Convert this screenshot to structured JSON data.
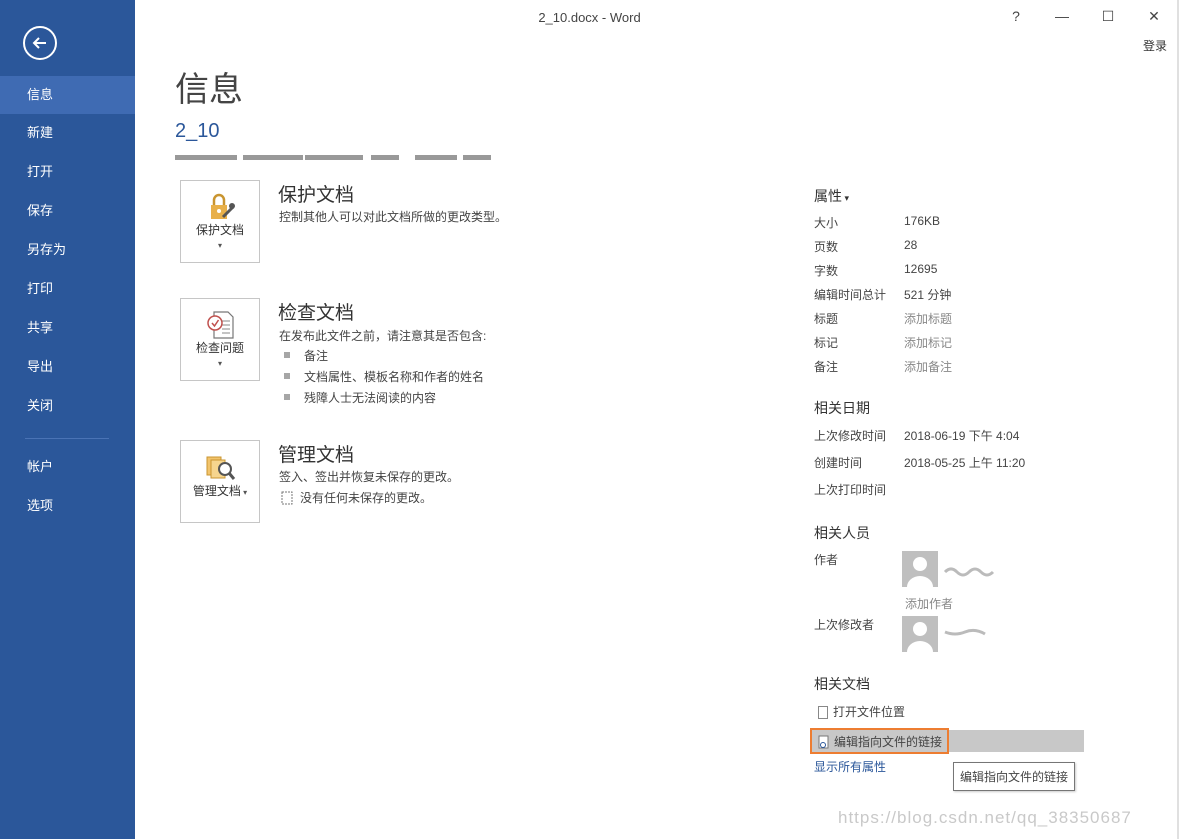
{
  "window": {
    "title": "2_10.docx - Word",
    "help_glyph": "?",
    "minimize_glyph": "—",
    "maximize_glyph": "☐",
    "close_glyph": "✕",
    "signin_label": "登录"
  },
  "sidebar": {
    "back_icon": "back-arrow-icon",
    "items": [
      {
        "label": "信息",
        "active": true
      },
      {
        "label": "新建"
      },
      {
        "label": "打开"
      },
      {
        "label": "保存"
      },
      {
        "label": "另存为"
      },
      {
        "label": "打印"
      },
      {
        "label": "共享"
      },
      {
        "label": "导出"
      },
      {
        "label": "关闭"
      },
      {
        "label": "帐户"
      },
      {
        "label": "选项"
      }
    ],
    "accent_color": "#2b579a"
  },
  "main": {
    "page_title": "信息",
    "doc_name": "2_10",
    "sections": [
      {
        "tile_label": "保护文档",
        "icon": "lock-key-icon",
        "title": "保护文档",
        "description": "控制其他人可以对此文档所做的更改类型。"
      },
      {
        "tile_label": "检查问题",
        "icon": "inspect-document-icon",
        "title": "检查文档",
        "description": "在发布此文件之前，请注意其是否包含:",
        "bullets": [
          "备注",
          "文档属性、模板名称和作者的姓名",
          "残障人士无法阅读的内容"
        ]
      },
      {
        "tile_label": "管理文档",
        "icon": "manage-document-icon",
        "title": "管理文档",
        "description": "签入、签出并恢复未保存的更改。",
        "note": "没有任何未保存的更改。"
      }
    ]
  },
  "properties": {
    "header": "属性",
    "items": [
      {
        "label": "大小",
        "value": "176KB"
      },
      {
        "label": "页数",
        "value": "28"
      },
      {
        "label": "字数",
        "value": "12695"
      },
      {
        "label": "编辑时间总计",
        "value": "521 分钟"
      },
      {
        "label": "标题",
        "value": "添加标题",
        "placeholder": true
      },
      {
        "label": "标记",
        "value": "添加标记",
        "placeholder": true
      },
      {
        "label": "备注",
        "value": "添加备注",
        "placeholder": true
      }
    ],
    "dates": {
      "title": "相关日期",
      "items": [
        {
          "label": "上次修改时间",
          "value": "2018-06-19 下午 4:04"
        },
        {
          "label": "创建时间",
          "value": "2018-05-25 上午 11:20"
        },
        {
          "label": "上次打印时间",
          "value": ""
        }
      ]
    },
    "people": {
      "title": "相关人员",
      "author_label": "作者",
      "add_author": "添加作者",
      "last_modified_by_label": "上次修改者"
    },
    "related_docs": {
      "title": "相关文档",
      "open_location": "打开文件位置",
      "edit_links": "编辑指向文件的链接",
      "show_all": "显示所有属性"
    },
    "tooltip": "编辑指向文件的链接"
  },
  "watermark": "https://blog.csdn.net/qq_38350687"
}
